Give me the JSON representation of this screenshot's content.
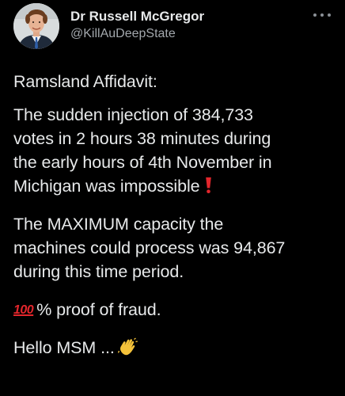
{
  "author": {
    "display_name": "Dr Russell McGregor",
    "handle": "@KillAuDeepState"
  },
  "header": {
    "more_icon": "more-horizontal-icon"
  },
  "tweet": {
    "p1": "Ramsland Affidavit:",
    "p2_lines": [
      "The sudden injection of 384,733",
      "votes in 2 hours 38 minutes during",
      "the early hours of 4th November in",
      "Michigan was impossible"
    ],
    "p3_lines": [
      "The MAXIMUM capacity the",
      "machines could process was 94,867",
      "during this time period."
    ],
    "p4_emoji": "100-emoji-icon",
    "p4_emoji_text": "100",
    "p4_text": "% proof of fraud.",
    "p5_text": "Hello MSM ...",
    "p5_emoji": "waving-hand-icon",
    "p2_emoji": "exclamation-mark-icon"
  },
  "colors": {
    "background": "#000000",
    "text": "#e7e9ea",
    "secondary_text": "#a3a8ad",
    "exclamation_red": "#e3262c"
  }
}
